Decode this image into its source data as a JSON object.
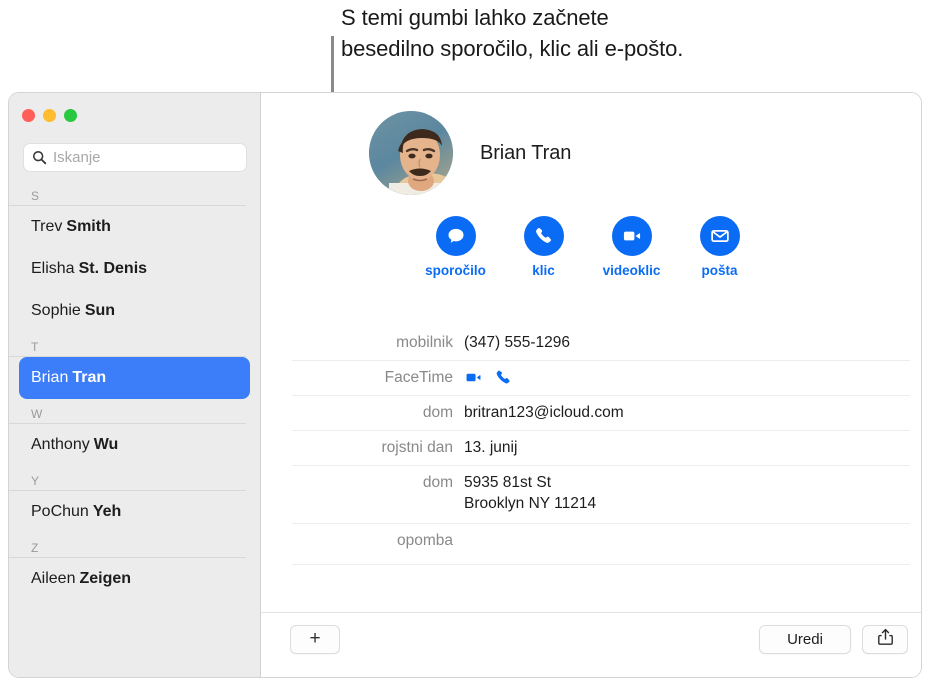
{
  "annotation": {
    "text": "S temi gumbi lahko začnete\nbesedilno sporočilo, klic ali e-pošto."
  },
  "window": {
    "traffic_lights": [
      {
        "name": "close",
        "color": "#ff5f57"
      },
      {
        "name": "minimize",
        "color": "#febc2e"
      },
      {
        "name": "zoom",
        "color": "#28c840"
      }
    ]
  },
  "sidebar": {
    "search": {
      "placeholder": "Iskanje",
      "value": "",
      "icon": "search-icon"
    },
    "sections": [
      {
        "letter": "S",
        "contacts": [
          {
            "first": "Trev",
            "last": "Smith",
            "selected": false
          },
          {
            "first": "Elisha",
            "last": "St. Denis",
            "selected": false
          },
          {
            "first": "Sophie",
            "last": "Sun",
            "selected": false
          }
        ]
      },
      {
        "letter": "T",
        "contacts": [
          {
            "first": "Brian",
            "last": "Tran",
            "selected": true
          }
        ]
      },
      {
        "letter": "W",
        "contacts": [
          {
            "first": "Anthony",
            "last": "Wu",
            "selected": false
          }
        ]
      },
      {
        "letter": "Y",
        "contacts": [
          {
            "first": "PoChun",
            "last": "Yeh",
            "selected": false
          }
        ]
      },
      {
        "letter": "Z",
        "contacts": [
          {
            "first": "Aileen",
            "last": "Zeigen",
            "selected": false
          }
        ]
      }
    ],
    "selection_color": "#3c7dfa"
  },
  "detail": {
    "contact_name": "Brian Tran",
    "avatar": "contact-photo",
    "accent_color": "#0a6cf5",
    "actions": [
      {
        "label": "sporočilo",
        "icon": "message-icon"
      },
      {
        "label": "klic",
        "icon": "phone-icon"
      },
      {
        "label": "videoklic",
        "icon": "video-icon"
      },
      {
        "label": "pošta",
        "icon": "mail-icon"
      }
    ],
    "fields": [
      {
        "label": "mobilnik",
        "value": "(347) 555-1296",
        "type": "text"
      },
      {
        "label": "FaceTime",
        "value": "",
        "type": "icons",
        "icons": [
          "video-icon",
          "phone-icon"
        ]
      },
      {
        "label": "dom",
        "value": "britran123@icloud.com",
        "type": "text"
      },
      {
        "label": "rojstni dan",
        "value": "13. junij",
        "type": "text"
      },
      {
        "label": "dom",
        "value": "5935 81st St\nBrooklyn NY 11214",
        "type": "text"
      },
      {
        "label": "opomba",
        "value": "",
        "type": "text"
      }
    ]
  },
  "toolbar": {
    "add_label": "+",
    "edit_label": "Uredi",
    "share_icon": "share-icon"
  }
}
